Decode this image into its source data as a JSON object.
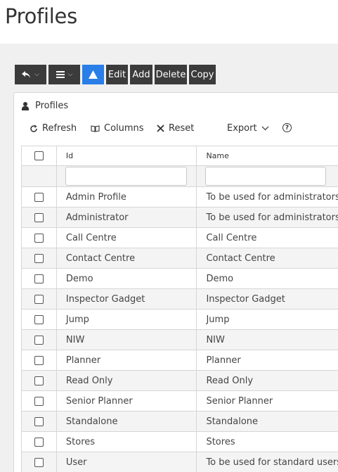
{
  "page": {
    "title": "Profiles"
  },
  "toolbar": {
    "edit_label": "Edit",
    "add_label": "Add",
    "delete_label": "Delete",
    "copy_label": "Copy"
  },
  "panel": {
    "heading": "Profiles",
    "actions": {
      "refresh": "Refresh",
      "columns": "Columns",
      "reset": "Reset",
      "export": "Export"
    }
  },
  "table": {
    "columns": {
      "id": "Id",
      "name": "Name"
    },
    "filters": {
      "id": "",
      "name": ""
    },
    "rows": [
      {
        "id": "Admin Profile",
        "name": "To be used for administrators"
      },
      {
        "id": "Administrator",
        "name": "To be used for administrators"
      },
      {
        "id": "Call Centre",
        "name": "Call Centre"
      },
      {
        "id": "Contact Centre",
        "name": "Contact Centre"
      },
      {
        "id": "Demo",
        "name": "Demo"
      },
      {
        "id": "Inspector Gadget",
        "name": "Inspector Gadget"
      },
      {
        "id": "Jump",
        "name": "Jump"
      },
      {
        "id": "NIW",
        "name": "NIW"
      },
      {
        "id": "Planner",
        "name": "Planner"
      },
      {
        "id": "Read Only",
        "name": "Read Only"
      },
      {
        "id": "Senior Planner",
        "name": "Senior Planner"
      },
      {
        "id": "Standalone",
        "name": "Standalone"
      },
      {
        "id": "Stores",
        "name": "Stores"
      },
      {
        "id": "User",
        "name": "To be used for standard users"
      }
    ]
  },
  "colors": {
    "toolbar": "#3b3b3b",
    "accent": "#2a7ee8",
    "background": "#f0f0f0"
  },
  "icons": [
    "undo-icon",
    "menu-icon",
    "warning-icon",
    "user-icon",
    "refresh-icon",
    "columns-icon",
    "close-icon",
    "chevron-down-icon",
    "help-icon"
  ]
}
